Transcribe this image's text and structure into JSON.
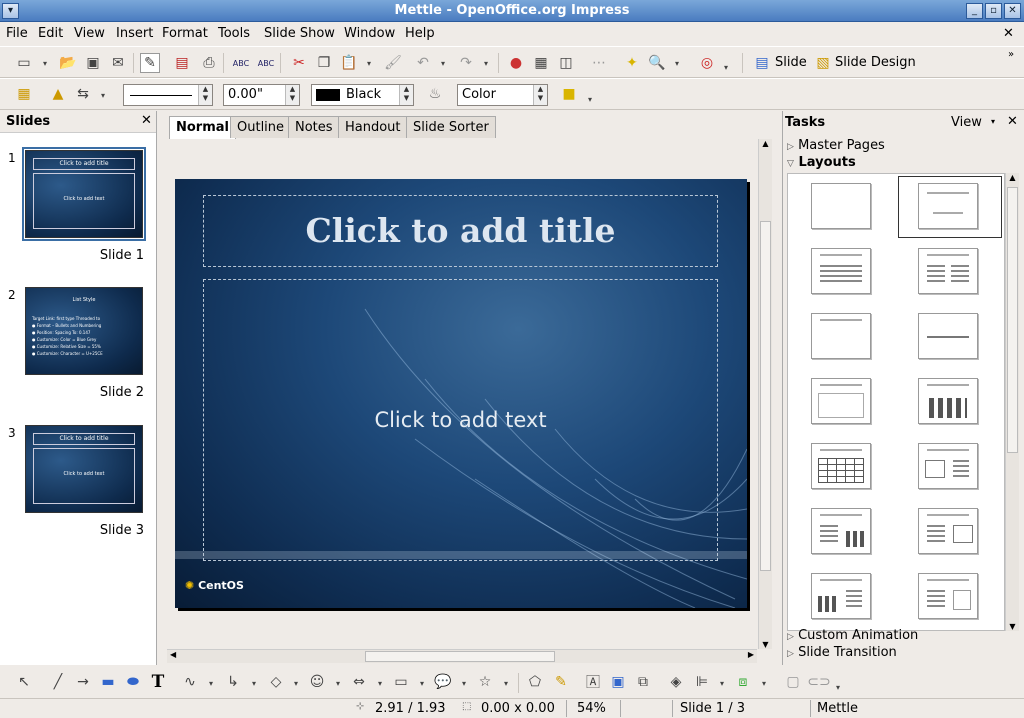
{
  "window": {
    "title": "Mettle - OpenOffice.org Impress"
  },
  "menu": [
    "File",
    "Edit",
    "View",
    "Insert",
    "Format",
    "Tools",
    "Slide Show",
    "Window",
    "Help"
  ],
  "toolbar1": {
    "slide_label": "Slide",
    "slide_design_label": "Slide Design"
  },
  "toolbar2": {
    "line_width": "0.00\"",
    "color_name": "Black",
    "area_style": "Color"
  },
  "slides_panel": {
    "title": "Slides",
    "slides": [
      {
        "num": "1",
        "label": "Slide 1",
        "title": "Click to add title",
        "body": "Click to add text"
      },
      {
        "num": "2",
        "label": "Slide 2",
        "title": "List Style",
        "body": "Target Link: first type Threaded to\n● Format – Bullets and Numbering\n● Position: Spacing To: 0.147\n● Customize: Color = Blue Grey\n● Customize: Relative Size = 55%\n● Customize: Character = U+25CE"
      },
      {
        "num": "3",
        "label": "Slide 3",
        "title": "Click to add title",
        "body": "Click to add text"
      }
    ]
  },
  "view_tabs": [
    "Normal",
    "Outline",
    "Notes",
    "Handout",
    "Slide Sorter"
  ],
  "slide": {
    "title_placeholder": "Click to add title",
    "text_placeholder": "Click to add text",
    "logo_text": "CentOS"
  },
  "tasks": {
    "title": "Tasks",
    "view_label": "View",
    "sections": {
      "master_pages": "Master Pages",
      "layouts": "Layouts",
      "custom_animation": "Custom Animation",
      "slide_transition": "Slide Transition"
    }
  },
  "status": {
    "position": "2.91 / 1.93",
    "size": "0.00 x 0.00",
    "zoom": "54%",
    "page": "Slide 1 / 3",
    "design": "Mettle"
  },
  "colors": {
    "titlebar": "#4a7cc0",
    "slide_bg": "#1d4878",
    "selection": "#3a6ea5"
  }
}
